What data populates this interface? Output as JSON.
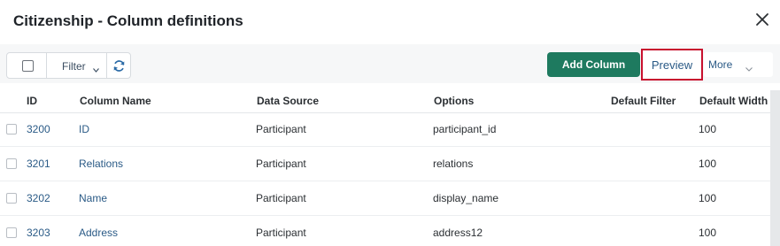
{
  "dialog": {
    "title": "Citizenship - Column definitions",
    "close_icon": "close-icon"
  },
  "toolbar": {
    "filter_label": "Filter",
    "refresh_icon": "refresh-icon",
    "add_column_label": "Add Column",
    "preview_label": "Preview",
    "more_label": "More",
    "add_column_color": "#1e7a5f",
    "highlight_color": "#c8102e"
  },
  "table": {
    "columns": [
      "ID",
      "Column Name",
      "Data Source",
      "Options",
      "Default Filter",
      "Default Width"
    ],
    "rows": [
      {
        "id": "3200",
        "name": "ID",
        "source": "Participant",
        "options": "participant_id",
        "filter": "",
        "width": "100"
      },
      {
        "id": "3201",
        "name": "Relations",
        "source": "Participant",
        "options": "relations",
        "filter": "",
        "width": "100"
      },
      {
        "id": "3202",
        "name": "Name",
        "source": "Participant",
        "options": "display_name",
        "filter": "",
        "width": "100"
      },
      {
        "id": "3203",
        "name": "Address",
        "source": "Participant",
        "options": "address12",
        "filter": "",
        "width": "100"
      }
    ]
  }
}
